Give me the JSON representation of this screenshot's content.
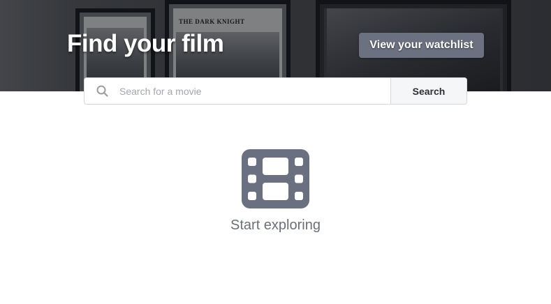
{
  "hero": {
    "title": "Find your film",
    "poster_text": "THE DARK KNIGHT",
    "watchlist_button_label": "View your watchlist"
  },
  "search": {
    "placeholder": "Search for a movie",
    "value": "",
    "button_label": "Search",
    "icon": "search-icon"
  },
  "empty_state": {
    "icon": "film-icon",
    "message": "Start exploring"
  },
  "colors": {
    "hero_overlay": "#14161a",
    "button_bg": "#6b7180",
    "icon_gray": "#6b7080",
    "text_gray": "#6b6f77",
    "search_button_bg": "#f5f6f8"
  }
}
